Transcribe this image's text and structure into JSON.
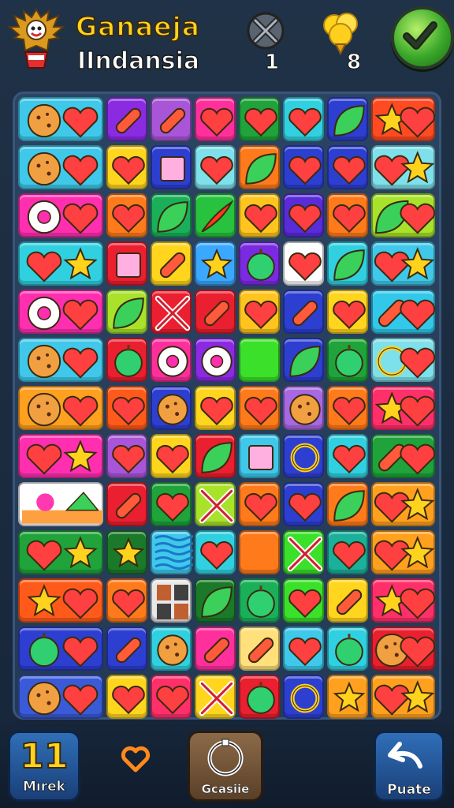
{
  "header": {
    "title": "Ganaeja",
    "subtitle": "IIndansia",
    "tool_count": "1",
    "coin_count": "8",
    "icons": {
      "emblem": "garuda-emblem-icon",
      "tool": "crossed-tools-icon",
      "coin": "gold-nugget-icon",
      "confirm": "checkmark-icon"
    }
  },
  "footer": {
    "moves_value": "11",
    "moves_label": "Mırek",
    "heart_icon": "heart-icon",
    "center_label": "Gcasiie",
    "undo_label": "Puate"
  },
  "board": {
    "rows": [
      [
        {
          "c": "#3fc8ea",
          "s": "cookie"
        },
        {
          "c": "#8a2be2",
          "s": "pill"
        },
        {
          "c": "#a855d8",
          "s": "pill"
        },
        {
          "c": "#ff2f9c",
          "s": "heart"
        },
        {
          "c": "#1fa33a",
          "s": "heart"
        },
        {
          "c": "#31d0e0",
          "s": "heart"
        },
        {
          "c": "#2d3fd0",
          "s": "leaf"
        },
        {
          "c": "#ff4a22",
          "s": "star"
        }
      ],
      [
        {
          "c": "#3fc8ea",
          "s": "cookie"
        },
        {
          "c": "#ffd51e",
          "s": "heart"
        },
        {
          "c": "#2d3fd0",
          "s": "square"
        },
        {
          "c": "#7ee0ea",
          "s": "heart"
        },
        {
          "c": "#ff7a1a",
          "s": "leaf"
        },
        {
          "c": "#2d3fd0",
          "s": "heart"
        },
        {
          "c": "#2d3fd0",
          "s": "heart"
        },
        {
          "c": "#7ee0ea",
          "s": "heart"
        }
      ],
      [
        {
          "c": "#ff2fb0",
          "s": "donut"
        },
        {
          "c": "#ff7a1a",
          "s": "heart"
        },
        {
          "c": "#1ab05a",
          "s": "leaf"
        },
        {
          "c": "#27c23e",
          "s": "pepper"
        },
        {
          "c": "#ffc51e",
          "s": "heart"
        },
        {
          "c": "#5a2bd8",
          "s": "heart"
        },
        {
          "c": "#ff7a1a",
          "s": "heart"
        },
        {
          "c": "#a8e22a",
          "s": "leaf"
        }
      ],
      [
        {
          "c": "#31d0e0",
          "s": "heart"
        },
        {
          "c": "#ea1f2f",
          "s": "square"
        },
        {
          "c": "#ffd51e",
          "s": "pill"
        },
        {
          "c": "#3aa8ff",
          "s": "star"
        },
        {
          "c": "#7a2be2",
          "s": "apple"
        },
        {
          "c": "#ffffff",
          "s": "heart"
        },
        {
          "c": "#31d0e0",
          "s": "leaf"
        },
        {
          "c": "#3fc8ea",
          "s": "heart"
        }
      ],
      [
        {
          "c": "#ff2fb0",
          "s": "donut"
        },
        {
          "c": "#a8e22a",
          "s": "leaf"
        },
        {
          "c": "#ea1f2f",
          "s": "cross"
        },
        {
          "c": "#ea1f2f",
          "s": "pill"
        },
        {
          "c": "#ffc51e",
          "s": "heart"
        },
        {
          "c": "#2d3fd0",
          "s": "pill"
        },
        {
          "c": "#ffd51e",
          "s": "heart"
        },
        {
          "c": "#31c8ea",
          "s": "pill"
        }
      ],
      [
        {
          "c": "#3fc8ea",
          "s": "cookie"
        },
        {
          "c": "#ea1f2f",
          "s": "apple"
        },
        {
          "c": "#ff2f9c",
          "s": "donut"
        },
        {
          "c": "#8a2be2",
          "s": "donut"
        },
        {
          "c": "#3ae02a",
          "s": "none"
        },
        {
          "c": "#2d3fd0",
          "s": "leaf"
        },
        {
          "c": "#1fa33a",
          "s": "apple"
        },
        {
          "c": "#7ee0ea",
          "s": "circle"
        }
      ],
      [
        {
          "c": "#ffa01e",
          "s": "cookie"
        },
        {
          "c": "#ff5a1a",
          "s": "heart"
        },
        {
          "c": "#2d3fd0",
          "s": "cookie"
        },
        {
          "c": "#ffd51e",
          "s": "heart"
        },
        {
          "c": "#ff7a1a",
          "s": "heart"
        },
        {
          "c": "#a868e2",
          "s": "cookie"
        },
        {
          "c": "#ff7a1a",
          "s": "heart"
        },
        {
          "c": "#ff2f6a",
          "s": "star"
        }
      ],
      [
        {
          "c": "#ff2fb0",
          "s": "heart"
        },
        {
          "c": "#a855d8",
          "s": "heart"
        },
        {
          "c": "#ffd51e",
          "s": "heart"
        },
        {
          "c": "#ea1f2f",
          "s": "leaf"
        },
        {
          "c": "#3fc8ea",
          "s": "square"
        },
        {
          "c": "#2d3fd0",
          "s": "circle"
        },
        {
          "c": "#31d0e0",
          "s": "heart"
        },
        {
          "c": "#1fa33a",
          "s": "pill"
        }
      ],
      [
        {
          "c": "#ffffff",
          "s": "scene"
        },
        {
          "c": "#ea1f2f",
          "s": "pill"
        },
        {
          "c": "#1fa33a",
          "s": "heart"
        },
        {
          "c": "#a8e22a",
          "s": "cross"
        },
        {
          "c": "#ff7a1a",
          "s": "heart"
        },
        {
          "c": "#2d3fd0",
          "s": "heart"
        },
        {
          "c": "#ff7a1a",
          "s": "leaf"
        },
        {
          "c": "#ffa01e",
          "s": "heart"
        }
      ],
      [
        {
          "c": "#1fa33a",
          "s": "heart"
        },
        {
          "c": "#1a7a2a",
          "s": "star"
        },
        {
          "c": "#3fc8ea",
          "s": "waves"
        },
        {
          "c": "#31d0e0",
          "s": "heart"
        },
        {
          "c": "#ff7a1a",
          "s": "none"
        },
        {
          "c": "#3ae02a",
          "s": "cross"
        },
        {
          "c": "#1ab09a",
          "s": "heart"
        },
        {
          "c": "#ffa01e",
          "s": "heart"
        }
      ],
      [
        {
          "c": "#ff5a1a",
          "s": "star"
        },
        {
          "c": "#ff7a1a",
          "s": "heart"
        },
        {
          "c": "#e8e8e8",
          "s": "tiles"
        },
        {
          "c": "#1a7a2a",
          "s": "leaf"
        },
        {
          "c": "#1ab05a",
          "s": "apple"
        },
        {
          "c": "#3ae02a",
          "s": "heart"
        },
        {
          "c": "#ffd51e",
          "s": "pill"
        },
        {
          "c": "#ff2f6a",
          "s": "star"
        }
      ],
      [
        {
          "c": "#2d3fd0",
          "s": "apple"
        },
        {
          "c": "#2d3fd0",
          "s": "pill"
        },
        {
          "c": "#31d0e0",
          "s": "cookie"
        },
        {
          "c": "#ff2f9c",
          "s": "pill"
        },
        {
          "c": "#ffe07a",
          "s": "pill"
        },
        {
          "c": "#3fc8ea",
          "s": "heart"
        },
        {
          "c": "#31d0e0",
          "s": "apple"
        },
        {
          "c": "#ea1f2f",
          "s": "cookie"
        }
      ],
      [
        {
          "c": "#3a5ad8",
          "s": "cookie"
        },
        {
          "c": "#ffd51e",
          "s": "heart"
        },
        {
          "c": "#ff2f6a",
          "s": "heart"
        },
        {
          "c": "#ffd51e",
          "s": "cross"
        },
        {
          "c": "#ea1f2f",
          "s": "apple"
        },
        {
          "c": "#2d3fd0",
          "s": "circle"
        },
        {
          "c": "#ffa01e",
          "s": "star"
        },
        {
          "c": "#ffa01e",
          "s": "heart"
        }
      ]
    ]
  }
}
